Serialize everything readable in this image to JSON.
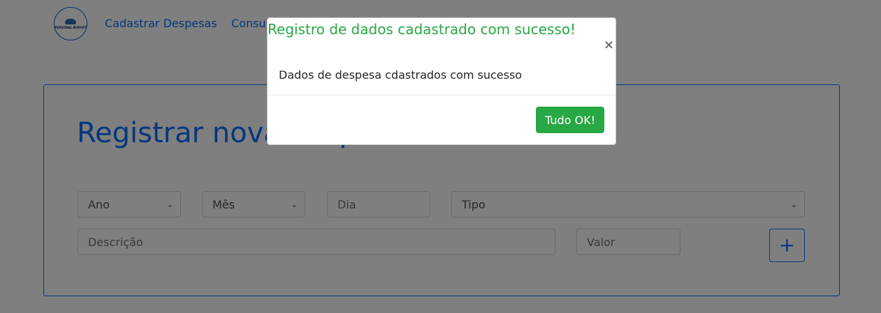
{
  "nav": {
    "logo_text": "PERSONAL BUDGET",
    "links": [
      "Cadastrar Despesas",
      "Consultar Despesas"
    ]
  },
  "form": {
    "title": "Registrar nova despesa",
    "ano": "Ano",
    "mes": "Mês",
    "dia_placeholder": "Dia",
    "tipo": "Tipo",
    "descricao_placeholder": "Descrição",
    "valor_placeholder": "Valor",
    "add_icon": "plus-icon",
    "add_label": "+"
  },
  "modal": {
    "title": "Registro de dados cadastrado com sucesso!",
    "close_label": "×",
    "body": "Dados de despesa cdastrados com sucesso",
    "ok_label": "Tudo OK!"
  },
  "colors": {
    "primary": "#0d6efd",
    "success": "#28a745",
    "backdrop": "rgba(0,0,0,0.5)"
  }
}
